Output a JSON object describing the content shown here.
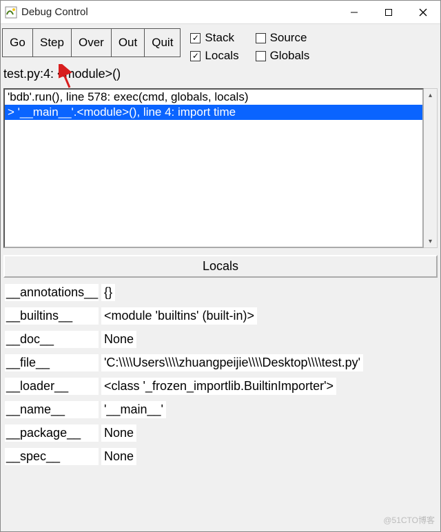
{
  "window": {
    "title": "Debug Control"
  },
  "buttons": {
    "go": "Go",
    "step": "Step",
    "over": "Over",
    "out": "Out",
    "quit": "Quit"
  },
  "checks": {
    "stack": {
      "label": "Stack",
      "checked": true
    },
    "source": {
      "label": "Source",
      "checked": false
    },
    "locals": {
      "label": "Locals",
      "checked": true
    },
    "globals": {
      "label": "Globals",
      "checked": false
    }
  },
  "current": "test.py:4: <module>()",
  "stack": [
    {
      "text": "'bdb'.run(), line 578: exec(cmd, globals, locals)",
      "selected": false
    },
    {
      "text": "> '__main__'.<module>(), line 4: import time",
      "selected": true
    }
  ],
  "locals_header": "Locals",
  "locals": [
    {
      "name": "__annotations__",
      "value": "{}"
    },
    {
      "name": "__builtins__",
      "value": "<module 'builtins' (built-in)>"
    },
    {
      "name": "__doc__",
      "value": "None"
    },
    {
      "name": "__file__",
      "value": "'C:\\\\\\\\Users\\\\\\\\zhuangpeijie\\\\\\\\Desktop\\\\\\\\test.py'"
    },
    {
      "name": "__loader__",
      "value": "<class '_frozen_importlib.BuiltinImporter'>"
    },
    {
      "name": "__name__",
      "value": "'__main__'"
    },
    {
      "name": "__package__",
      "value": "None"
    },
    {
      "name": "__spec__",
      "value": "None"
    }
  ],
  "watermark": "@51CTO博客"
}
